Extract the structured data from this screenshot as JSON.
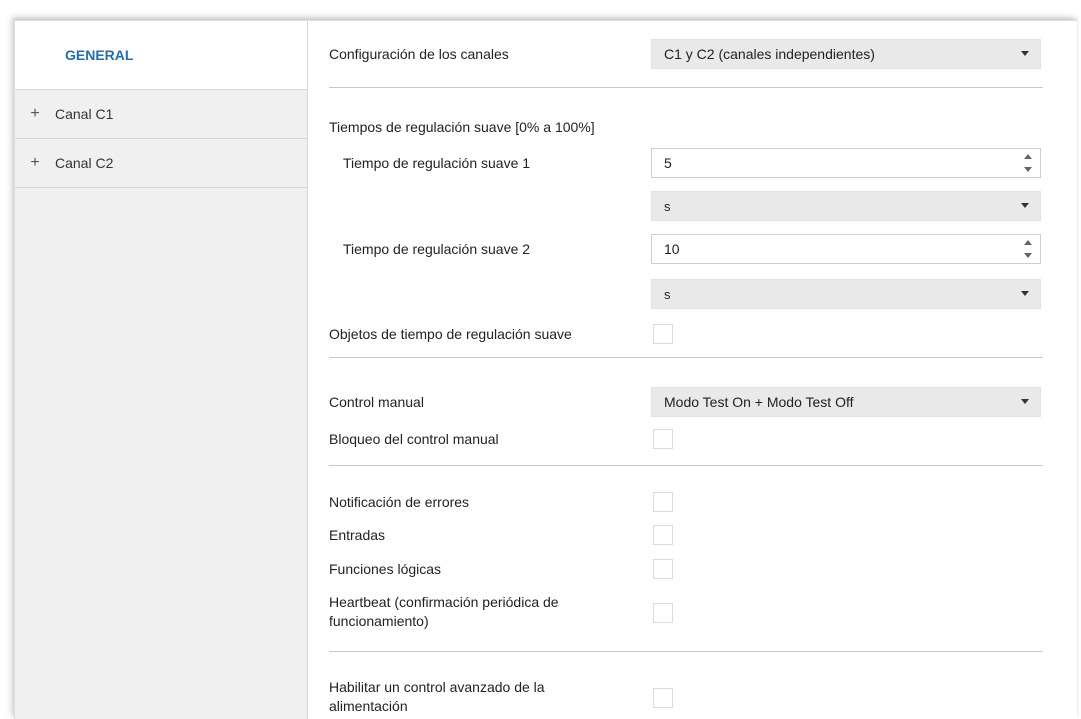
{
  "sidebar": {
    "items": [
      {
        "label": "GENERAL"
      },
      {
        "label": "Canal C1",
        "expand": "+"
      },
      {
        "label": "Canal C2",
        "expand": "+"
      }
    ]
  },
  "main": {
    "channels_config": {
      "label": "Configuración de los canales",
      "value": "C1 y C2 (canales independientes)"
    },
    "soft_times_header": "Tiempos de regulación suave [0% a 100%]",
    "soft_time_1": {
      "label": "Tiempo de regulación suave 1",
      "value": "5",
      "unit": "s"
    },
    "soft_time_2": {
      "label": "Tiempo de regulación suave 2",
      "value": "10",
      "unit": "s"
    },
    "soft_time_objects": {
      "label": "Objetos de tiempo de regulación suave",
      "checked": false
    },
    "manual_control": {
      "label": "Control manual",
      "value": "Modo Test On + Modo Test Off"
    },
    "manual_lock": {
      "label": "Bloqueo del control manual",
      "checked": false
    },
    "error_notification": {
      "label": "Notificación de errores",
      "checked": false
    },
    "inputs": {
      "label": "Entradas",
      "checked": false
    },
    "logic_functions": {
      "label": "Funciones lógicas",
      "checked": false
    },
    "heartbeat": {
      "label_line1": "Heartbeat (confirmación periódica de",
      "label_line2": "funcionamiento)",
      "checked": false
    },
    "advanced_power": {
      "label_line1": "Habilitar un control avanzado de la",
      "label_line2": "alimentación",
      "checked": false
    }
  },
  "colors": {
    "accent": "#1f6db3",
    "sidebar_bg": "#f0f0f0",
    "select_bg": "#e9e9e9"
  }
}
